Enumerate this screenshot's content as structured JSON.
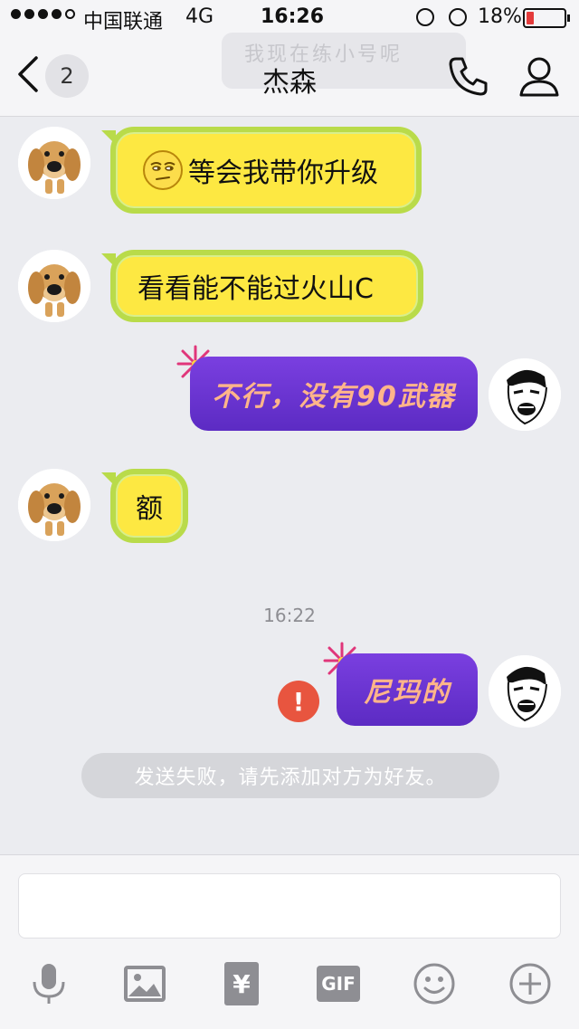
{
  "status_bar": {
    "carrier": "中国联通",
    "network": "4G",
    "time": "16:26",
    "battery_percent": "18%",
    "battery_level": 0.18,
    "battery_color": "#e43b3b"
  },
  "nav": {
    "faded_text": "我现在练小号呢",
    "unread_count": "2",
    "title": "杰森",
    "icons": [
      "back-chevron-icon",
      "phone-icon",
      "profile-icon"
    ]
  },
  "messages": [
    {
      "side": "left",
      "text": "等会我带你升级",
      "emoji": "smirk-emoji-icon"
    },
    {
      "side": "left",
      "text": "看看能不能过火山C"
    },
    {
      "side": "right",
      "text": "不行，没有90武器"
    },
    {
      "side": "left",
      "text": "额"
    }
  ],
  "timestamp": "16:22",
  "failed_message": {
    "side": "right",
    "text": "尼玛的",
    "error_icon": "!"
  },
  "notice": "发送失败，请先添加对方为好友。",
  "composer": {
    "input_value": "",
    "tools": [
      "microphone-icon",
      "image-icon",
      "red-packet-icon",
      "gif-icon",
      "emoji-icon",
      "plus-icon"
    ],
    "gif_label": "GIF",
    "red_packet_symbol": "¥"
  },
  "colors": {
    "lemon_fill": "#fde842",
    "lemon_border": "#b9db4a",
    "purple_bubble": "#6a35d6",
    "purple_text": "#ffb58a",
    "error": "#e8553f"
  }
}
